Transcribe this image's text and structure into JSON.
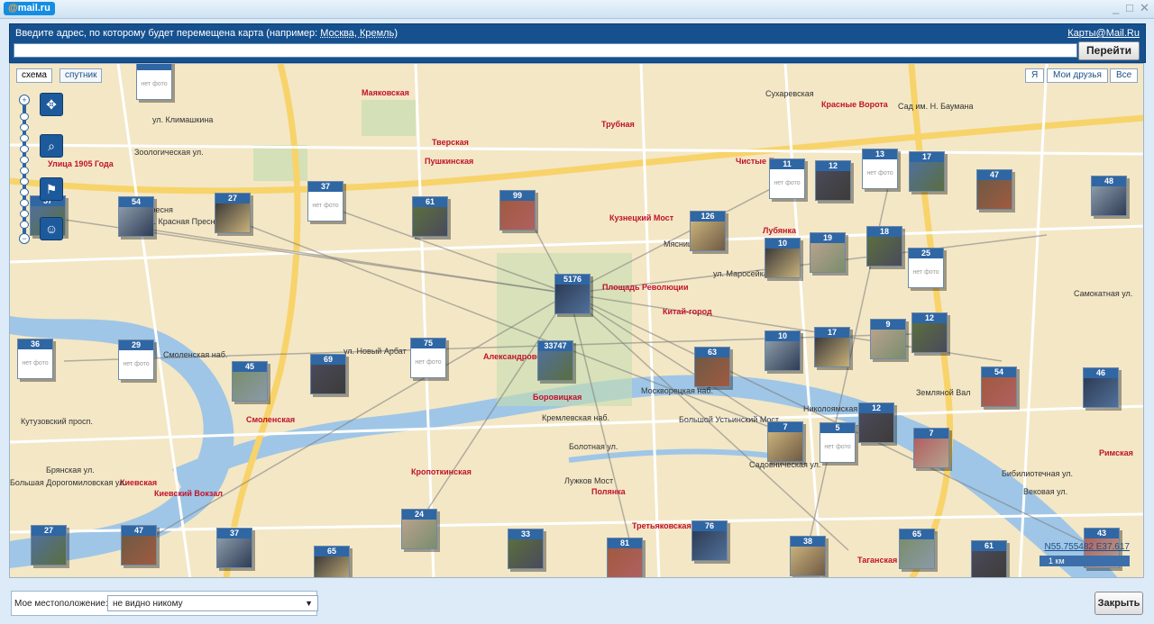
{
  "app": {
    "logo": "mail.ru",
    "logo_at": "@",
    "logo_rest": "mail.ru"
  },
  "window": {
    "minimize": "_",
    "maximize": "□",
    "close": "✕"
  },
  "header": {
    "hint_prefix": "Введите адрес, по которому будет перемещена карта (например: ",
    "hint_example": "Москва, Кремль",
    "hint_suffix": ")",
    "maps_link": "Карты@Mail.Ru",
    "address_value": "",
    "go_button": "Перейти"
  },
  "map": {
    "types": [
      "схема",
      "спутник"
    ],
    "active_type": "схема",
    "filters": [
      "Я",
      "Мои друзья",
      "Все"
    ],
    "coords": "N55.755482 E37.617",
    "scale": "1 км",
    "no_photo": "нет фото",
    "labels": [
      {
        "text": "ул. Климашкина"
      },
      {
        "text": "Зоологическая ул."
      },
      {
        "text": "Улица 1905 Года",
        "metro": true
      },
      {
        "text": "Пресня"
      },
      {
        "text": "ул. Красная Пресня"
      },
      {
        "text": "Маяковская",
        "metro": true
      },
      {
        "text": "Тверская",
        "metro": true
      },
      {
        "text": "Пушкинская",
        "metro": true
      },
      {
        "text": "Трубная",
        "metro": true
      },
      {
        "text": "Сухаревская"
      },
      {
        "text": "Красные Ворота",
        "metro": true
      },
      {
        "text": "Сад им. Н. Баумана"
      },
      {
        "text": "Кузнецкий Мост",
        "metro": true
      },
      {
        "text": "Чистые Пруды",
        "metro": true
      },
      {
        "text": "Лубянка",
        "metro": true
      },
      {
        "text": "Площадь Революции",
        "metro": true
      },
      {
        "text": "Китай-город",
        "metro": true
      },
      {
        "text": "ул. Маросейка"
      },
      {
        "text": "ул. Новый Арбат"
      },
      {
        "text": "Александровский Сад",
        "metro": true
      },
      {
        "text": "Боровицкая",
        "metro": true
      },
      {
        "text": "Смоленская",
        "metro": true
      },
      {
        "text": "Киевская",
        "metro": true
      },
      {
        "text": "Киевский Вокзал",
        "metro": true
      },
      {
        "text": "Кропоткинская",
        "metro": true
      },
      {
        "text": "Полянка",
        "metro": true
      },
      {
        "text": "Третьяковская",
        "metro": true
      },
      {
        "text": "Таганская",
        "metro": true
      },
      {
        "text": "Римская",
        "metro": true
      },
      {
        "text": "Большой Устьинский Мост"
      },
      {
        "text": "Лужков Мост"
      },
      {
        "text": "Болотная ул."
      },
      {
        "text": "Кремлевская наб."
      },
      {
        "text": "Москворецкая наб."
      },
      {
        "text": "Смоленская наб."
      },
      {
        "text": "Кутузовский просп."
      },
      {
        "text": "Большая Дорогомиловская ул."
      },
      {
        "text": "Брянская ул."
      },
      {
        "text": "Садовническая ул."
      },
      {
        "text": "Николоямская ул."
      },
      {
        "text": "Земляной Вал"
      },
      {
        "text": "Бибилиотечная ул."
      },
      {
        "text": "Вековая ул."
      },
      {
        "text": "Самокатная ул."
      },
      {
        "text": "Мясницкая ул."
      }
    ],
    "photos": [
      {
        "count": "",
        "nofoto": true
      },
      {
        "count": "54"
      },
      {
        "count": "27"
      },
      {
        "count": "37",
        "nofoto": true
      },
      {
        "count": "61"
      },
      {
        "count": "99"
      },
      {
        "count": "5176"
      },
      {
        "count": "126"
      },
      {
        "count": "11",
        "nofoto": true
      },
      {
        "count": "12"
      },
      {
        "count": "13",
        "nofoto": true
      },
      {
        "count": "17"
      },
      {
        "count": "47"
      },
      {
        "count": "48"
      },
      {
        "count": "10"
      },
      {
        "count": "19"
      },
      {
        "count": "18"
      },
      {
        "count": "25",
        "nofoto": true
      },
      {
        "count": "36",
        "nofoto": true
      },
      {
        "count": "29",
        "nofoto": true
      },
      {
        "count": "45"
      },
      {
        "count": "69"
      },
      {
        "count": "75",
        "nofoto": true
      },
      {
        "count": "33747"
      },
      {
        "count": "63"
      },
      {
        "count": "10"
      },
      {
        "count": "17"
      },
      {
        "count": "9"
      },
      {
        "count": "12"
      },
      {
        "count": "54"
      },
      {
        "count": "46"
      },
      {
        "count": "7"
      },
      {
        "count": "5",
        "nofoto": true
      },
      {
        "count": "12"
      },
      {
        "count": "7"
      },
      {
        "count": "27"
      },
      {
        "count": "47"
      },
      {
        "count": "37"
      },
      {
        "count": "65"
      },
      {
        "count": "24"
      },
      {
        "count": "33"
      },
      {
        "count": "81"
      },
      {
        "count": "76"
      },
      {
        "count": "38"
      },
      {
        "count": "65"
      },
      {
        "count": "61"
      },
      {
        "count": "43"
      },
      {
        "count": "57"
      }
    ]
  },
  "footer": {
    "location_label": "Мое местоположение:",
    "location_value": "не видно никому",
    "close_button": "Закрыть"
  }
}
